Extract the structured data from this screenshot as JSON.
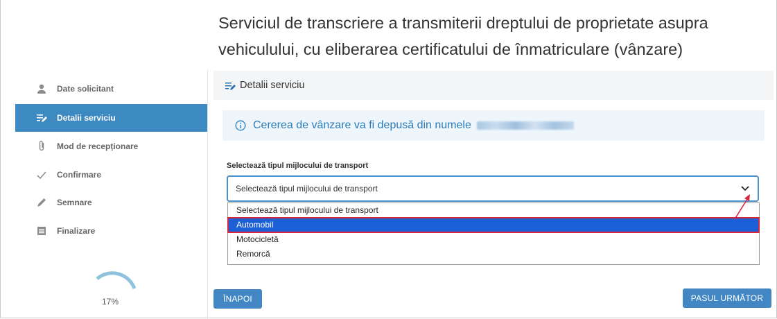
{
  "title": "Serviciul de transcriere a transmiterii dreptului de proprietate asupra vehiculului, cu eliberarea certificatului de înmatriculare (vânzare)",
  "sidebar": {
    "items": [
      {
        "label": "Date solicitant",
        "icon": "person-icon",
        "active": false
      },
      {
        "label": "Detalii serviciu",
        "icon": "list-edit-icon",
        "active": true
      },
      {
        "label": "Mod de recepționare",
        "icon": "paperclip-icon",
        "active": false
      },
      {
        "label": "Confirmare",
        "icon": "check-icon",
        "active": false
      },
      {
        "label": "Semnare",
        "icon": "pen-icon",
        "active": false
      },
      {
        "label": "Finalizare",
        "icon": "document-icon",
        "active": false
      }
    ],
    "progress": {
      "value": 0.17,
      "label": "17%"
    }
  },
  "panel": {
    "header": "Detalii serviciu",
    "info": "Cererea de vânzare va fi depusă din numele"
  },
  "form": {
    "label": "Selectează tipul mijlocului de transport",
    "selected": "Selectează tipul mijlocului de transport",
    "options": [
      "Selectează tipul mijlocului de transport",
      "Automobil",
      "Motocicletă",
      "Remorcă"
    ],
    "highlighted_option": "Automobil"
  },
  "buttons": {
    "back": "ÎNAPOI",
    "next": "PASUL URMĂTOR"
  },
  "colors": {
    "accent": "#3d8ac2",
    "info_bg": "#eef6fc",
    "highlight": "#1d5fd6",
    "annotation": "#d6263b"
  }
}
